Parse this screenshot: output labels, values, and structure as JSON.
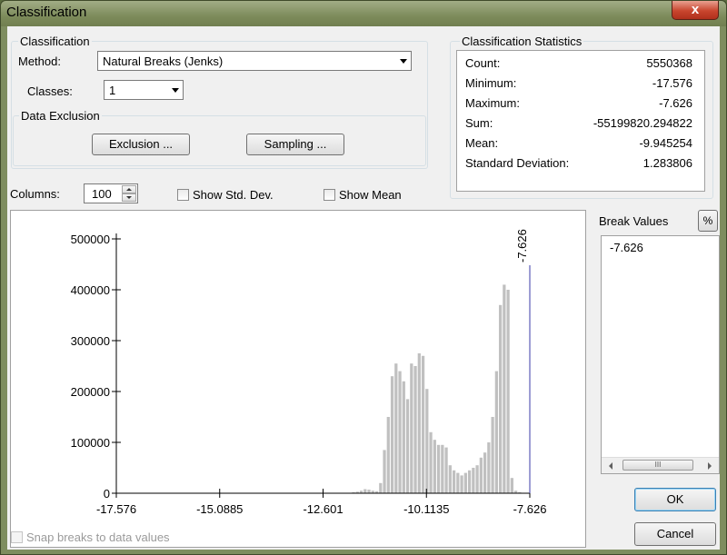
{
  "window": {
    "title": "Classification",
    "close_label": "x"
  },
  "classification": {
    "group_label": "Classification",
    "method_label": "Method:",
    "method_value": "Natural Breaks (Jenks)",
    "classes_label": "Classes:",
    "classes_value": "1"
  },
  "data_exclusion": {
    "group_label": "Data Exclusion",
    "exclusion_button": "Exclusion ...",
    "sampling_button": "Sampling ..."
  },
  "statistics": {
    "group_label": "Classification Statistics",
    "rows": [
      {
        "key": "Count:",
        "value": "5550368"
      },
      {
        "key": "Minimum:",
        "value": "-17.576"
      },
      {
        "key": "Maximum:",
        "value": "-7.626"
      },
      {
        "key": "Sum:",
        "value": "-55199820.294822"
      },
      {
        "key": "Mean:",
        "value": "-9.945254"
      },
      {
        "key": "Standard Deviation:",
        "value": "1.283806"
      }
    ]
  },
  "columns": {
    "label": "Columns:",
    "value": "100"
  },
  "options": {
    "show_std_dev": "Show Std. Dev.",
    "show_mean": "Show Mean",
    "snap_breaks": "Snap breaks to data values"
  },
  "break_values": {
    "label": "Break Values",
    "percent_button": "%",
    "items": [
      "-7.626"
    ],
    "scroll_thumb": "III"
  },
  "buttons": {
    "ok": "OK",
    "cancel": "Cancel"
  },
  "chart_data": {
    "type": "bar",
    "xlim": [
      -17.576,
      -7.626
    ],
    "ylim": [
      0,
      500000
    ],
    "x_ticks": [
      "-17.576",
      "-15.0885",
      "-12.601",
      "-10.1135",
      "-7.626"
    ],
    "y_ticks": [
      "0",
      "100000",
      "200000",
      "300000",
      "400000",
      "500000"
    ],
    "bins": 100,
    "values": [
      0,
      0,
      0,
      0,
      0,
      0,
      0,
      0,
      0,
      0,
      0,
      0,
      0,
      0,
      0,
      0,
      0,
      0,
      0,
      0,
      0,
      0,
      0,
      0,
      0,
      0,
      0,
      0,
      0,
      0,
      0,
      0,
      0,
      0,
      0,
      0,
      0,
      0,
      0,
      0,
      0,
      0,
      0,
      0,
      0,
      0,
      0,
      0,
      0,
      0,
      0,
      0,
      0,
      0,
      0,
      0,
      0,
      0,
      0,
      0,
      0,
      2000,
      3000,
      5000,
      8000,
      7000,
      5000,
      4000,
      20000,
      85000,
      150000,
      230000,
      255000,
      240000,
      220000,
      185000,
      255000,
      250000,
      275000,
      270000,
      205000,
      120000,
      105000,
      95000,
      95000,
      90000,
      55000,
      45000,
      40000,
      35000,
      40000,
      45000,
      50000,
      55000,
      70000,
      80000,
      100000,
      150000,
      240000,
      370000,
      410000,
      400000,
      30000,
      5000,
      2000,
      0,
      0
    ],
    "break_value": -7.626,
    "break_label": "-7.626",
    "colors": {
      "bars": "#c0c0c0",
      "break_line": "#3b3ba8"
    }
  }
}
